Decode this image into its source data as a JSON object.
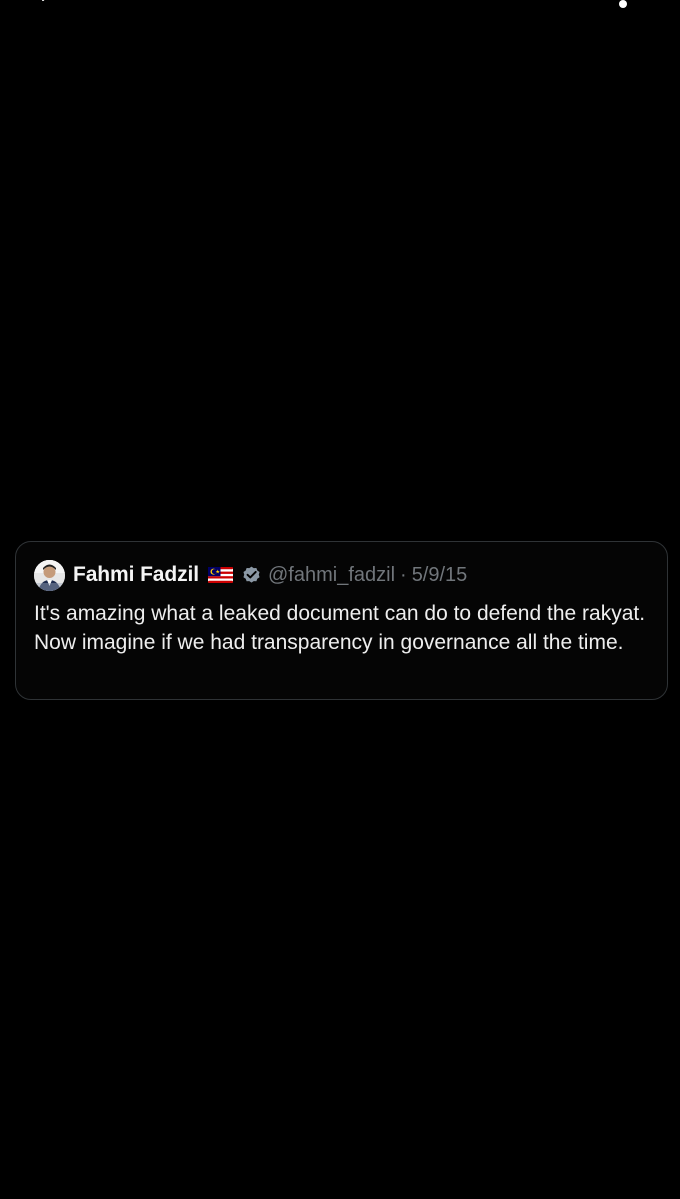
{
  "quote_tweet": {
    "author": {
      "display_name": "Fahmi Fadzil",
      "flag_icon": "malaysia-flag-icon",
      "verified_icon": "verified-badge-icon",
      "handle": "@fahmi_fadzil"
    },
    "separator": "·",
    "date": "5/9/15",
    "text": "It's amazing what a leaked document can do to defend the rakyat. Now imagine if we had transparency in governance all the time."
  },
  "colors": {
    "background": "#000000",
    "card_border": "#2f3336",
    "text": "#e7e9ea",
    "muted_text": "#71767b",
    "verified": "#8b98a5"
  }
}
